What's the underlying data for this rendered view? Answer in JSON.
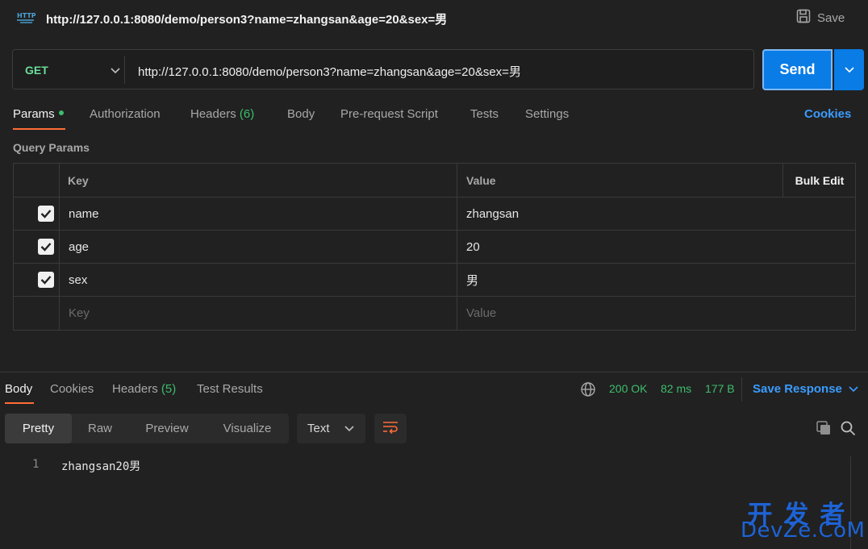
{
  "titlebar": {
    "icon_text": "HTTP",
    "url": "http://127.0.0.1:8080/demo/person3?name=zhangsan&age=20&sex=男",
    "save_label": "Save"
  },
  "request": {
    "method": "GET",
    "url": "http://127.0.0.1:8080/demo/person3?name=zhangsan&age=20&sex=男",
    "send_label": "Send"
  },
  "tabs": [
    {
      "label": "Params",
      "active": true
    },
    {
      "label": "Authorization"
    },
    {
      "label": "Headers",
      "count": "(6)"
    },
    {
      "label": "Body"
    },
    {
      "label": "Pre-request Script"
    },
    {
      "label": "Tests"
    },
    {
      "label": "Settings"
    }
  ],
  "cookies_label": "Cookies",
  "query_params": {
    "title": "Query Params",
    "headers": {
      "key": "Key",
      "value": "Value",
      "bulk_edit": "Bulk Edit"
    },
    "rows": [
      {
        "checked": true,
        "key": "name",
        "value": "zhangsan"
      },
      {
        "checked": true,
        "key": "age",
        "value": "20"
      },
      {
        "checked": true,
        "key": "sex",
        "value": "男"
      }
    ],
    "placeholder": {
      "key": "Key",
      "value": "Value"
    }
  },
  "response": {
    "tabs": [
      {
        "label": "Body",
        "active": true
      },
      {
        "label": "Cookies"
      },
      {
        "label": "Headers",
        "count": "(5)"
      },
      {
        "label": "Test Results"
      }
    ],
    "status": "200 OK",
    "time": "82 ms",
    "size": "177 B",
    "save_response_label": "Save Response",
    "views": [
      "Pretty",
      "Raw",
      "Preview",
      "Visualize"
    ],
    "format": "Text",
    "lines": [
      {
        "number": "1",
        "text": "zhangsan20男"
      }
    ]
  },
  "watermark": {
    "top": "开发者",
    "bottom": "DevZe.CoM"
  },
  "colors": {
    "accent_orange": "#ff6c37",
    "send_blue": "#0a7ce6",
    "link_blue": "#3b9cff",
    "success_green": "#3dbd6c",
    "method_green": "#6bdd9a"
  },
  "icons": [
    "http-icon",
    "save-icon",
    "chevron-down-icon",
    "checkbox-icon",
    "globe-icon",
    "wrap-lines-icon",
    "copy-icon",
    "search-icon"
  ]
}
